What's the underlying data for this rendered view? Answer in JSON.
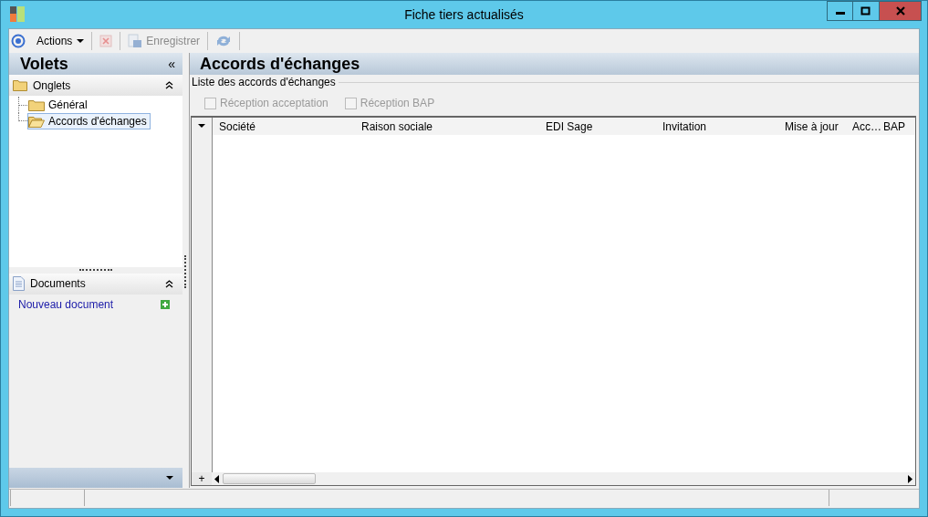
{
  "window": {
    "title": "Fiche tiers actualisés"
  },
  "toolbar": {
    "items": [
      {
        "kind": "menu",
        "label": "Actions"
      },
      {
        "kind": "delete",
        "disabled": true
      },
      {
        "kind": "save",
        "label": "Enregistrer",
        "disabled": true
      },
      {
        "kind": "refresh"
      }
    ]
  },
  "sidebar": {
    "title": "Volets",
    "collapse_glyph": "«",
    "sections": [
      {
        "kind": "tree",
        "title": "Onglets",
        "expanded": true,
        "items": [
          {
            "label": "Général",
            "selected": false
          },
          {
            "label": "Accords d'échanges",
            "selected": true
          }
        ]
      },
      {
        "kind": "links",
        "title": "Documents",
        "expanded": true,
        "links": [
          {
            "label": "Nouveau document"
          }
        ]
      }
    ]
  },
  "content": {
    "title": "Accords d'échanges",
    "group_title": "Liste des accords d'échanges",
    "checkboxes": [
      {
        "label": "Réception acceptation",
        "checked": false,
        "disabled": true
      },
      {
        "label": "Réception BAP",
        "checked": false,
        "disabled": true
      }
    ],
    "table": {
      "columns": [
        "Société",
        "Raison sociale",
        "EDI Sage",
        "Invitation",
        "Mise à jour",
        "Acc…",
        "BAP"
      ],
      "add_glyph": "+"
    }
  }
}
